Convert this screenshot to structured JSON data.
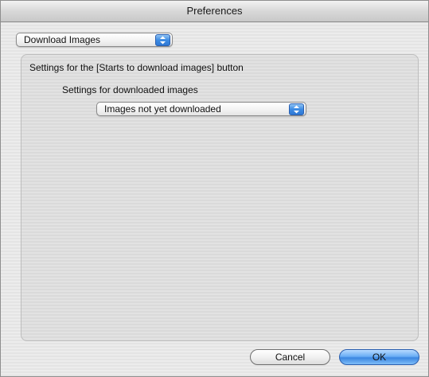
{
  "window": {
    "title": "Preferences"
  },
  "category_popup": {
    "selected": "Download Images",
    "icon": "popup-arrows-icon"
  },
  "settings_button_label": "Settings for the [Starts to download images] button",
  "settings_images_label": "Settings for downloaded images",
  "images_popup": {
    "selected": "Images not yet downloaded",
    "icon": "popup-arrows-icon"
  },
  "buttons": {
    "cancel": "Cancel",
    "ok": "OK"
  },
  "colors": {
    "accent": "#3b86e0"
  }
}
